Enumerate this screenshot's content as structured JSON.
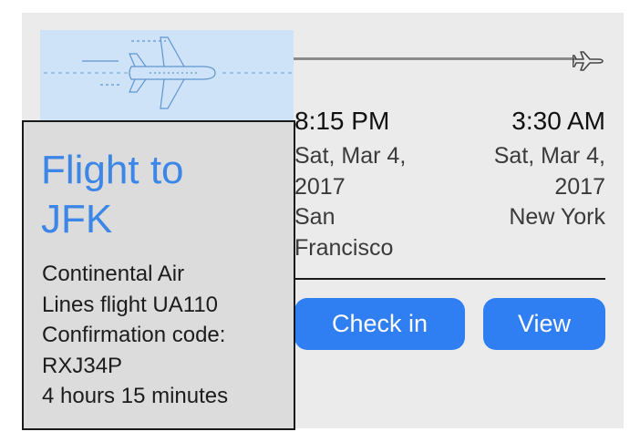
{
  "flight": {
    "title_line1": "Flight to",
    "title_line2": "JFK",
    "airline_line1": "Continental Air",
    "airline_line2": "Lines flight UA110",
    "confirmation_label": "Confirmation code:",
    "confirmation_code": "RXJ34P",
    "duration": "4 hours 15 minutes"
  },
  "departure": {
    "time": "8:15 PM",
    "date_line1": "Sat, Mar 4,",
    "date_line2": "2017",
    "city_line1": "San",
    "city_line2": "Francisco"
  },
  "arrival": {
    "time": "3:30 AM",
    "date_line1": "Sat, Mar 4,",
    "date_line2": "2017",
    "city": "New York"
  },
  "actions": {
    "check_in_label": "Check in",
    "view_label": "View"
  },
  "icons": {
    "banner": "airplane-illustration-icon",
    "destination": "airplane-outline-icon"
  },
  "colors": {
    "accent": "#2f7ef2",
    "title": "#3b86e6",
    "banner_bg": "#cfe3f8"
  }
}
